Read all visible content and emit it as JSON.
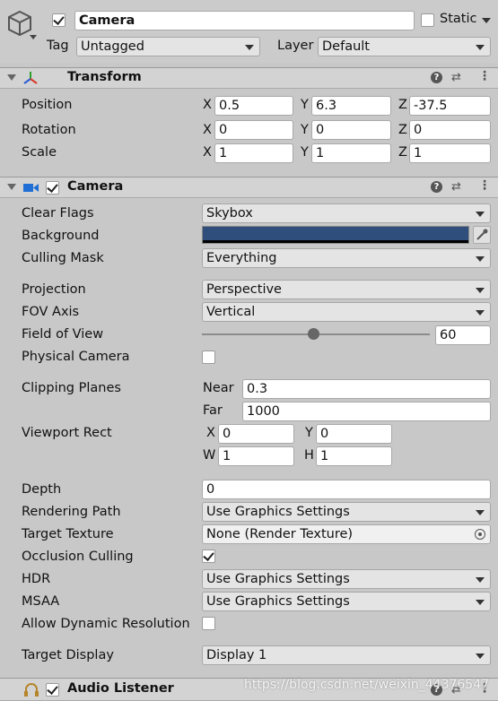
{
  "go": {
    "name": "Camera",
    "static_label": "Static",
    "tag_label": "Tag",
    "tag_value": "Untagged",
    "layer_label": "Layer",
    "layer_value": "Default"
  },
  "transform": {
    "title": "Transform",
    "position_label": "Position",
    "rotation_label": "Rotation",
    "scale_label": "Scale",
    "x": "X",
    "y": "Y",
    "z": "Z",
    "position": [
      "0.5",
      "6.3",
      "-37.5"
    ],
    "rotation": [
      "0",
      "0",
      "0"
    ],
    "scale": [
      "1",
      "1",
      "1"
    ]
  },
  "camera": {
    "title": "Camera",
    "clear_flags_label": "Clear Flags",
    "clear_flags": "Skybox",
    "background_label": "Background",
    "background_color": "#2f4e7c",
    "culling_mask_label": "Culling Mask",
    "culling_mask": "Everything",
    "projection_label": "Projection",
    "projection": "Perspective",
    "fov_axis_label": "FOV Axis",
    "fov_axis": "Vertical",
    "fov_label": "Field of View",
    "fov": "60",
    "fov_slider_fraction": 0.49,
    "physical_label": "Physical Camera",
    "clipping_label": "Clipping Planes",
    "near_label": "Near",
    "near": "0.3",
    "far_label": "Far",
    "far": "1000",
    "viewport_label": "Viewport Rect",
    "vp_x_label": "X",
    "vp_y_label": "Y",
    "vp_w_label": "W",
    "vp_h_label": "H",
    "vp_x": "0",
    "vp_y": "0",
    "vp_w": "1",
    "vp_h": "1",
    "depth_label": "Depth",
    "depth": "0",
    "rendering_path_label": "Rendering Path",
    "rendering_path": "Use Graphics Settings",
    "target_texture_label": "Target Texture",
    "target_texture": "None (Render Texture)",
    "occlusion_label": "Occlusion Culling",
    "hdr_label": "HDR",
    "hdr": "Use Graphics Settings",
    "msaa_label": "MSAA",
    "msaa": "Use Graphics Settings",
    "dynres_label": "Allow Dynamic Resolution",
    "target_display_label": "Target Display",
    "target_display": "Display 1"
  },
  "audio": {
    "title": "Audio Listener"
  },
  "watermark": "https://blog.csdn.net/weixin_44376547"
}
